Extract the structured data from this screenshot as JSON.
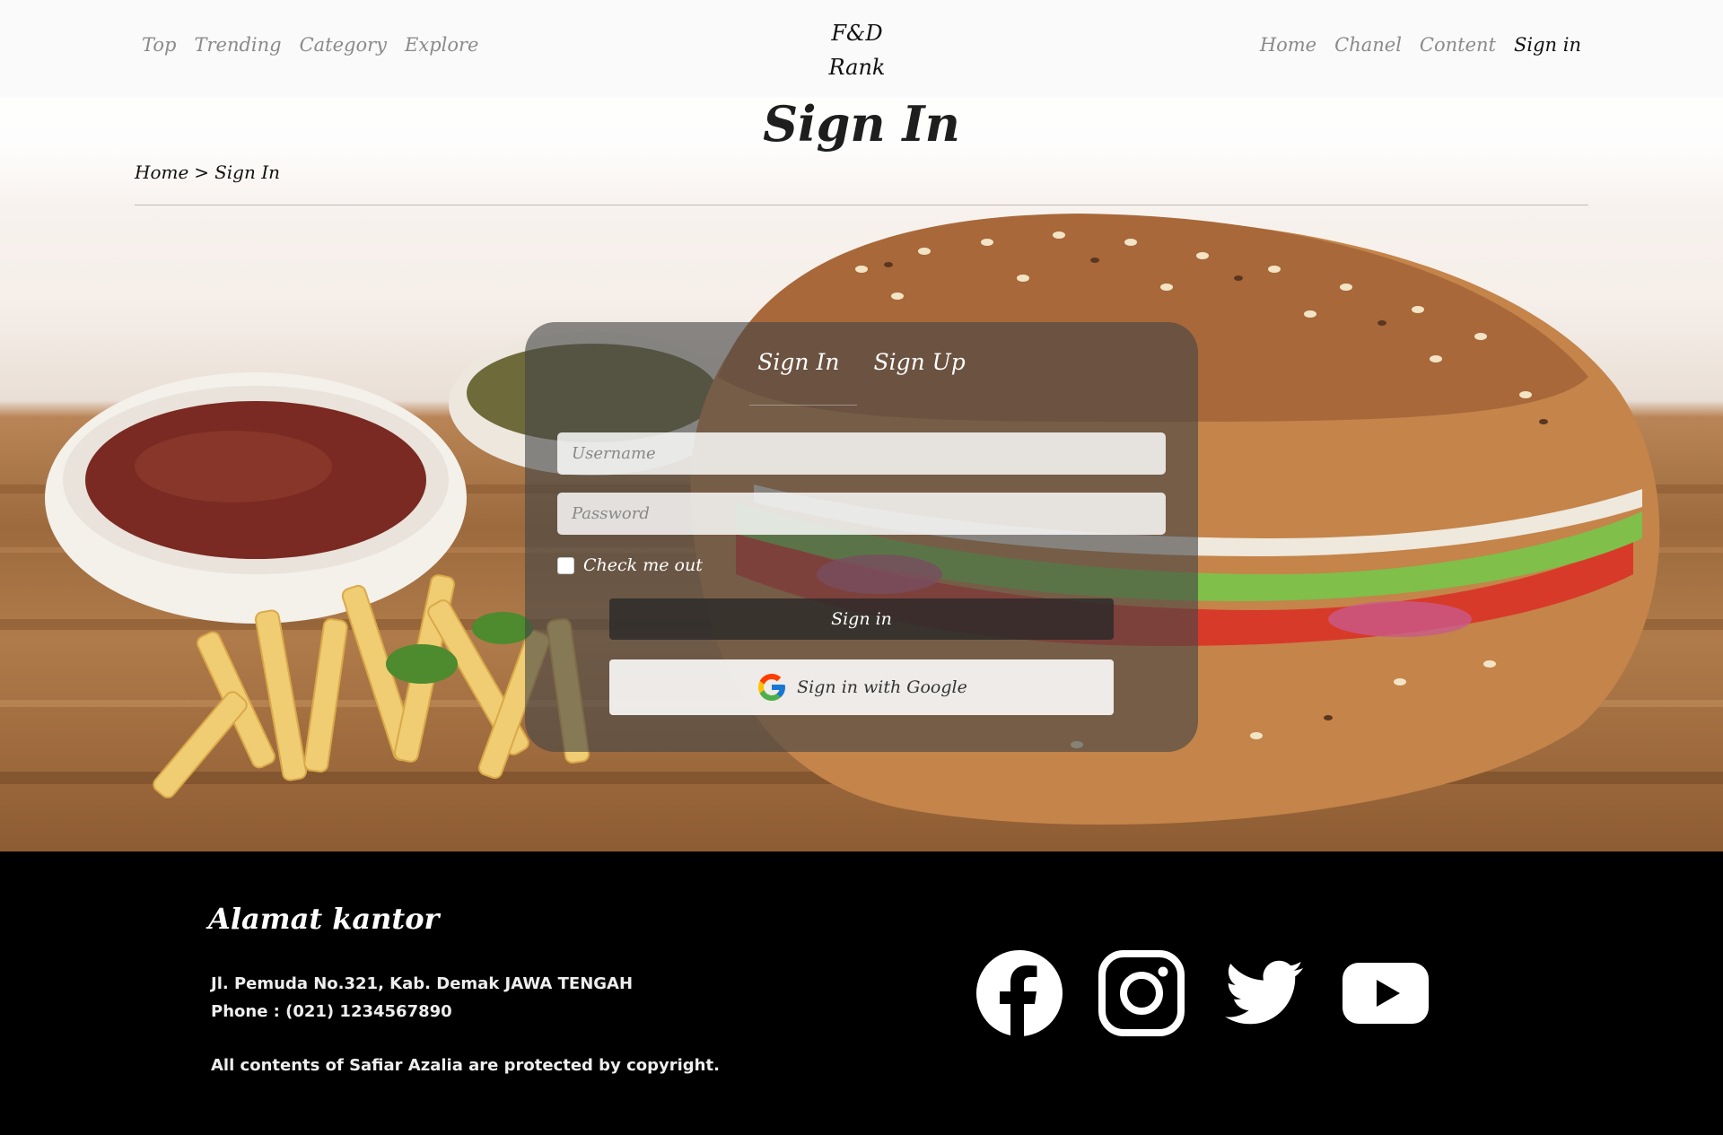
{
  "nav": {
    "left": [
      "Top",
      "Trending",
      "Category",
      "Explore"
    ],
    "brand_line1": "F&D",
    "brand_line2": "Rank",
    "right": [
      "Home",
      "Chanel",
      "Content",
      "Sign in"
    ]
  },
  "page": {
    "title": "Sign In",
    "breadcrumb": [
      "Home",
      ">",
      "Sign In"
    ]
  },
  "login": {
    "tabs": [
      "Sign In",
      "Sign Up"
    ],
    "username_placeholder": "Username",
    "password_placeholder": "Password",
    "remember_label": "Check me out",
    "signin_label": "Sign in",
    "google_label": "Sign in with Google"
  },
  "footer": {
    "heading": "Alamat kantor",
    "address": "Jl. Pemuda No.321, Kab. Demak JAWA TENGAH",
    "phone": "Phone : (021) 1234567890",
    "copyright": "All contents of Safiar Azalia are protected by copyright.",
    "socials": [
      "facebook-icon",
      "instagram-icon",
      "twitter-icon",
      "youtube-icon"
    ]
  },
  "colors": {
    "footer_bg": "#000000",
    "card_bg": "rgba(70,70,70,0.62)",
    "nav_inactive": "#8a8a8a",
    "nav_active": "#111111"
  }
}
